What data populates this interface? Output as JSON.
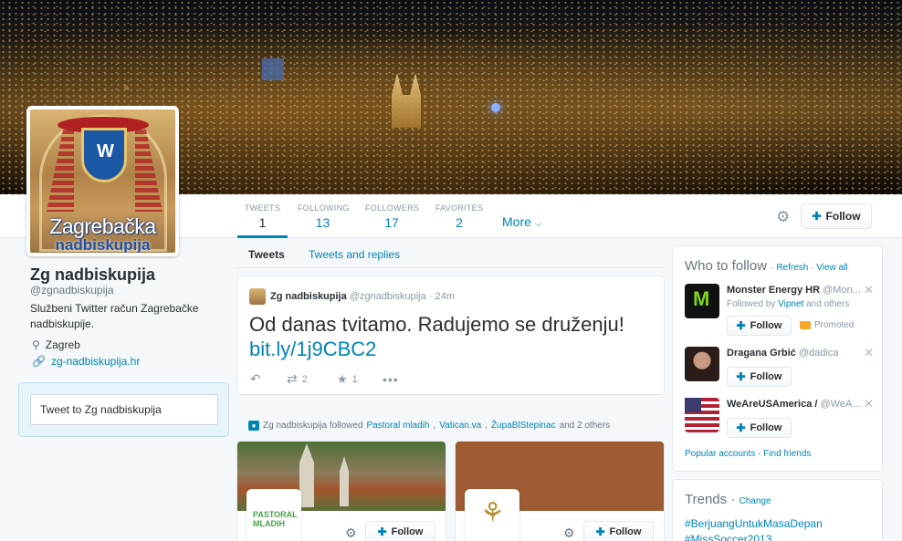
{
  "profile": {
    "avatar_text_line1": "Zagrebačka",
    "avatar_text_line2": "nadbiskupija",
    "name": "Zg nadbiskupija",
    "handle": "@zgnadbiskupija",
    "bio": "Službeni Twitter račun Zagrebačke nadbiskupije.",
    "location": "Zagreb",
    "url": "zg-nadbiskupija.hr",
    "tweet_box_placeholder": "Tweet to Zg nadbiskupija"
  },
  "nav": {
    "stats": [
      {
        "label": "TWEETS",
        "value": "1"
      },
      {
        "label": "FOLLOWING",
        "value": "13"
      },
      {
        "label": "FOLLOWERS",
        "value": "17"
      },
      {
        "label": "FAVORITES",
        "value": "2"
      }
    ],
    "more_label": "More",
    "follow_label": "Follow"
  },
  "timeline": {
    "tabs": [
      "Tweets",
      "Tweets and replies"
    ],
    "tweet": {
      "name": "Zg nadbiskupija",
      "handle": "@zgnadbiskupija",
      "separator": "·",
      "time": "24m",
      "text": "Od danas tvitamo. Radujemo se druženju!",
      "link": "bit.ly/1j9CBC2",
      "retweets": "2",
      "favorites": "1"
    },
    "followed_note": {
      "prefix": "Zg nadbiskupija followed",
      "accounts": [
        "Pastoral mladih",
        "Vatican.va",
        "ŽupaBlStepinac"
      ],
      "suffix": "and 2 others"
    },
    "cards": [
      {
        "avatar_text": "PASTORAL MLADIH",
        "follow_label": "Follow"
      },
      {
        "avatar_text": "",
        "follow_label": "Follow"
      }
    ]
  },
  "who_to_follow": {
    "title": "Who to follow",
    "refresh": "Refresh",
    "view_all": "View all",
    "suggestions": [
      {
        "name": "Monster Energy HR",
        "handle": "@Mon...",
        "sub_prefix": "Followed by",
        "sub_link": "Vipnet",
        "sub_suffix": "and others",
        "follow_label": "Follow",
        "promoted": "Promoted"
      },
      {
        "name": "Dragana Grbić",
        "handle": "@dadica",
        "follow_label": "Follow"
      },
      {
        "name": "WeAreUSAmerica /",
        "handle": "@WeA...",
        "follow_label": "Follow"
      }
    ],
    "popular": "Popular accounts",
    "find_friends": "Find friends"
  },
  "trends": {
    "title": "Trends",
    "change": "Change",
    "items": [
      "#BerjuangUntukMasaDepan",
      "#MissSoccer2013"
    ]
  },
  "colors": {
    "link": "#0084b4",
    "background": "#f5f8fa",
    "text": "#292f33",
    "muted": "#8899a6"
  }
}
